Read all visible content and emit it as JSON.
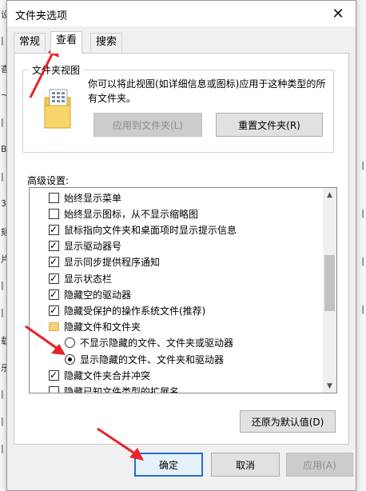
{
  "background_window": {
    "left_glyphs": [
      "设",
      "|",
      "杳",
      "~",
      "|",
      "B",
      "|",
      "3",
      "颏",
      "片",
      "|",
      "|",
      "载",
      "乐",
      "|",
      "|",
      "|"
    ],
    "right_glyphs": [
      "|",
      "|",
      "|",
      "|"
    ]
  },
  "dialog": {
    "title": "文件夹选项",
    "close_glyph": "✕"
  },
  "tabs": [
    {
      "label": "常规",
      "active": false
    },
    {
      "label": "查看",
      "active": true
    },
    {
      "label": "搜索",
      "active": false
    }
  ],
  "folder_view": {
    "legend": "文件夹视图",
    "description": "你可以将此视图(如详细信息或图标)应用于这种类型的所有文件夹。",
    "apply_button": "应用到文件夹(L)",
    "reset_button": "重置文件夹(R)"
  },
  "advanced": {
    "label": "高级设置:",
    "items": [
      {
        "type": "checkbox",
        "label": "始终显示菜单",
        "checked": false
      },
      {
        "type": "checkbox",
        "label": "始终显示图标，从不显示缩略图",
        "checked": false
      },
      {
        "type": "checkbox",
        "label": "鼠标指向文件夹和桌面项时显示提示信息",
        "checked": true
      },
      {
        "type": "checkbox",
        "label": "显示驱动器号",
        "checked": true
      },
      {
        "type": "checkbox",
        "label": "显示同步提供程序通知",
        "checked": true
      },
      {
        "type": "checkbox",
        "label": "显示状态栏",
        "checked": true
      },
      {
        "type": "checkbox",
        "label": "隐藏空的驱动器",
        "checked": true
      },
      {
        "type": "checkbox",
        "label": "隐藏受保护的操作系统文件(推荐)",
        "checked": true
      },
      {
        "type": "folder",
        "label": "隐藏文件和文件夹"
      },
      {
        "type": "radio",
        "label": "不显示隐藏的文件、文件夹或驱动器",
        "checked": false
      },
      {
        "type": "radio",
        "label": "显示隐藏的文件、文件夹和驱动器",
        "checked": true
      },
      {
        "type": "checkbox",
        "label": "隐藏文件夹合并冲突",
        "checked": true
      },
      {
        "type": "checkbox",
        "label": "隐藏已知文件类型的扩展名",
        "checked": false
      }
    ],
    "restore_button": "还原为默认值(D)"
  },
  "footer": {
    "ok_button": "确定",
    "cancel_button": "取消",
    "apply_button": "应用(A)"
  },
  "colors": {
    "annotation_arrow": "#e8232a",
    "primary_border": "#1f6ed4"
  }
}
